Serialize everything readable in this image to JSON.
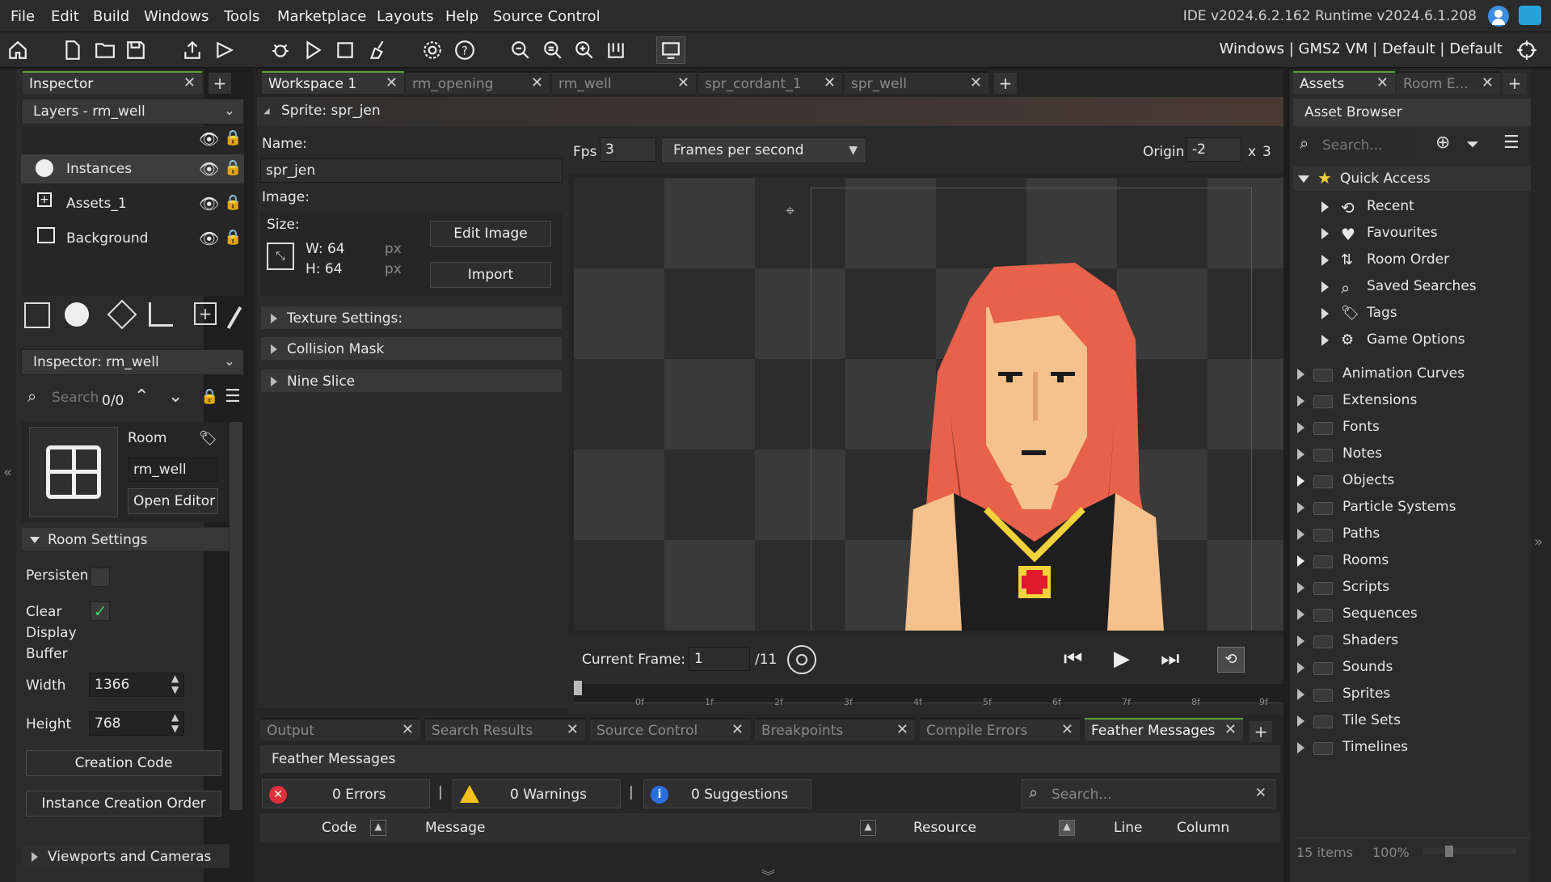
{
  "menu": [
    "File",
    "Edit",
    "Build",
    "Windows",
    "Tools",
    "Marketplace",
    "Layouts",
    "Help",
    "Source Control"
  ],
  "ide_version": "IDE v2024.6.2.162  Runtime v2024.6.1.208",
  "target": "Windows | GMS2 VM | Default | Default",
  "left": {
    "tab_label": "Inspector",
    "layers_dropdown": "Layers - rm_well",
    "layers": [
      "Instances",
      "Assets_1",
      "Background"
    ],
    "inspector_dropdown": "Inspector: rm_well",
    "search_placeholder": "Search",
    "search_count": "0/0",
    "room_label": "Room",
    "room_name": "rm_well",
    "open_editor": "Open Editor",
    "room_settings": "Room Settings",
    "persistent": "Persisten",
    "clear_display_buffer": "Clear\nDisplay\nBuffer",
    "width_label": "Width",
    "width_value": "1366",
    "height_label": "Height",
    "height_value": "768",
    "creation_code": "Creation Code",
    "instance_creation_order": "Instance Creation Order",
    "viewports": "Viewports and Cameras"
  },
  "workspace_tabs": [
    {
      "label": "Workspace 1",
      "active": true
    },
    {
      "label": "rm_opening",
      "active": false
    },
    {
      "label": "rm_well",
      "active": false
    },
    {
      "label": "spr_cordant_1",
      "active": false
    },
    {
      "label": "spr_well",
      "active": false
    }
  ],
  "sprite": {
    "header": "Sprite: spr_jen",
    "name_label": "Name:",
    "name_value": "spr_jen",
    "image_label": "Image:",
    "size_label": "Size:",
    "w_label": "W: 64",
    "h_label": "H: 64",
    "px": "px",
    "edit_image": "Edit Image",
    "import": "Import",
    "texture_settings": "Texture Settings:",
    "collision_mask": "Collision Mask",
    "nine_slice": "Nine Slice",
    "fps_label": "Fps",
    "fps_value": "3",
    "fps_mode": "Frames per second",
    "origin_label": "Origin",
    "origin_x": "-2",
    "origin_x_label": "x",
    "origin_y": "3",
    "current_frame_label": "Current Frame:",
    "current_frame_value": "1",
    "frame_total": "/11",
    "timeline_ticks": [
      "0f",
      "1f",
      "2f",
      "3f",
      "4f",
      "5f",
      "6f",
      "7f",
      "8f",
      "9f"
    ]
  },
  "bottom": {
    "tabs": [
      "Output",
      "Search Results",
      "Source Control",
      "Breakpoints",
      "Compile Errors",
      "Feather Messages"
    ],
    "active_tab": "Feather Messages",
    "title": "Feather Messages",
    "errors": "0 Errors",
    "warnings": "0 Warnings",
    "suggestions": "0 Suggestions",
    "search_placeholder": "Search...",
    "columns": [
      "Code",
      "Message",
      "Resource",
      "Line",
      "Column"
    ]
  },
  "right": {
    "tab_assets": "Assets",
    "tab_room": "Room E...",
    "browser_title": "Asset Browser",
    "search_placeholder": "Search...",
    "quick_access": "Quick Access",
    "quick_items": [
      "Recent",
      "Favourites",
      "Room Order",
      "Saved Searches",
      "Tags",
      "Game Options"
    ],
    "folders": [
      "Animation Curves",
      "Extensions",
      "Fonts",
      "Notes",
      "Objects",
      "Particle Systems",
      "Paths",
      "Rooms",
      "Scripts",
      "Sequences",
      "Shaders",
      "Sounds",
      "Sprites",
      "Tile Sets",
      "Timelines"
    ],
    "items_count": "15 items",
    "zoom": "100%"
  },
  "colors": {
    "accent": "#5a9f3a",
    "hair": "#e8614a",
    "skin": "#f5c18c",
    "gold": "#f2d23a"
  }
}
